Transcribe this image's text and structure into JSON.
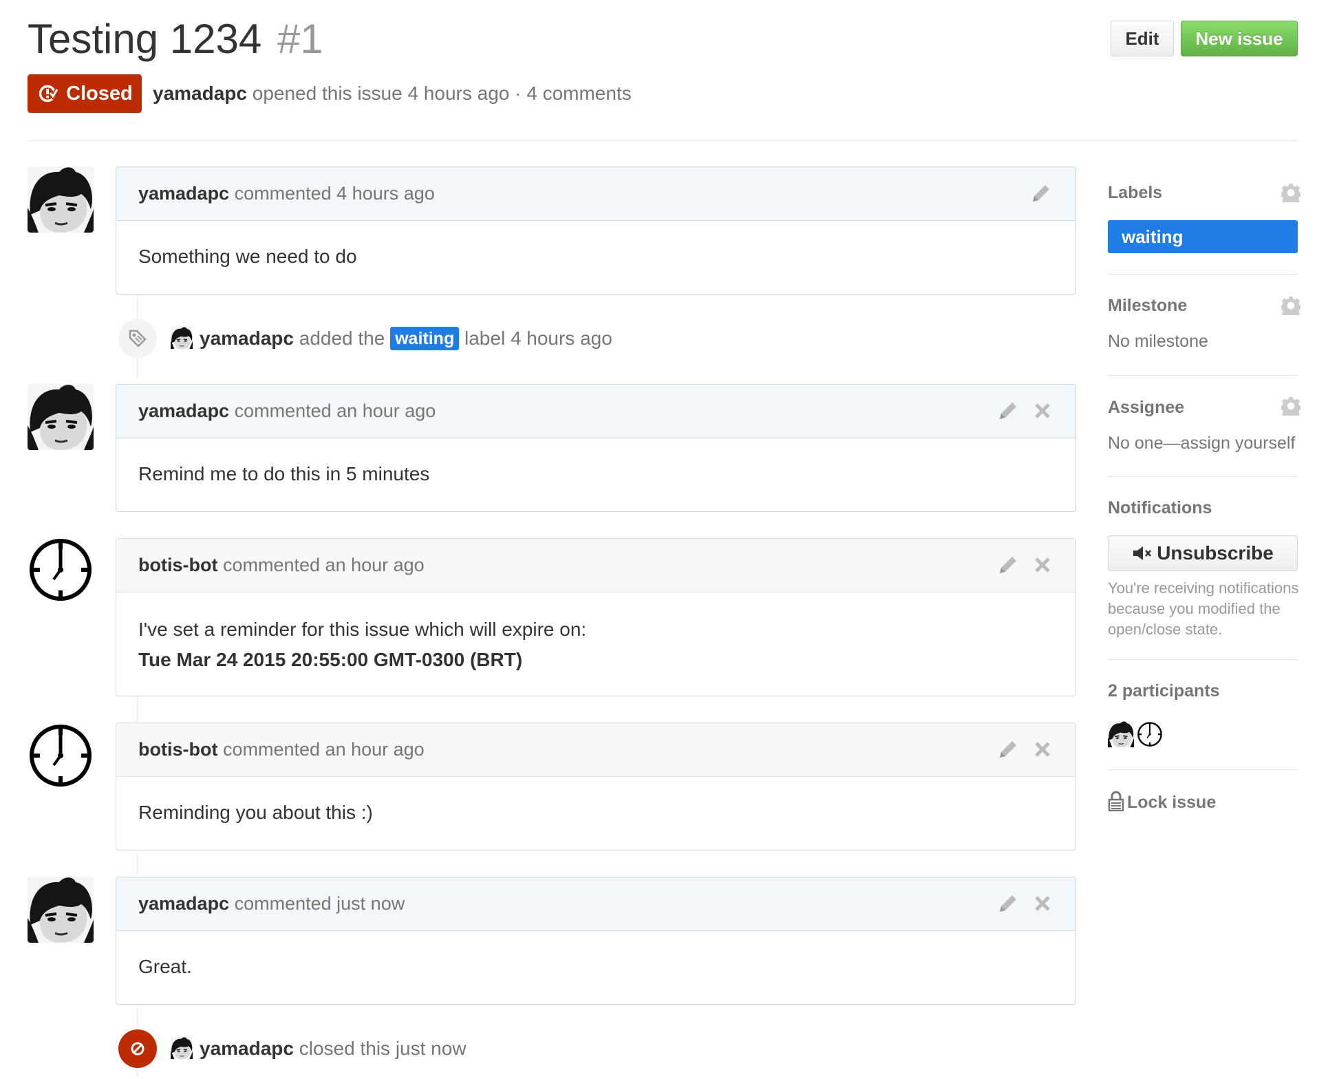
{
  "header": {
    "title": "Testing 1234",
    "number": "#1",
    "edit_label": "Edit",
    "new_issue_label": "New issue",
    "state": "Closed",
    "author": "yamadapc",
    "opened_text": "opened this issue 4 hours ago · 4 comments"
  },
  "timeline": {
    "c1": {
      "author": "yamadapc",
      "meta": "commented 4 hours ago",
      "body": "Something we need to do"
    },
    "ev1": {
      "author": "yamadapc",
      "pre": "added the",
      "label": "waiting",
      "post": "label 4 hours ago"
    },
    "c2": {
      "author": "yamadapc",
      "meta": "commented an hour ago",
      "body": "Remind me to do this in 5 minutes"
    },
    "c3": {
      "author": "botis-bot",
      "meta": "commented an hour ago",
      "body_line1": "I've set a reminder for this issue which will expire on:",
      "body_line2": "Tue Mar 24 2015 20:55:00 GMT-0300 (BRT)"
    },
    "c4": {
      "author": "botis-bot",
      "meta": "commented an hour ago",
      "body": "Reminding you about this :)"
    },
    "c5": {
      "author": "yamadapc",
      "meta": "commented just now",
      "body": "Great."
    },
    "ev2": {
      "author": "yamadapc",
      "text": "closed this just now"
    }
  },
  "sidebar": {
    "labels_heading": "Labels",
    "label_waiting": "waiting",
    "milestone_heading": "Milestone",
    "milestone_value": "No milestone",
    "assignee_heading": "Assignee",
    "assignee_value": "No one—assign yourself",
    "notifications_heading": "Notifications",
    "unsubscribe_label": "Unsubscribe",
    "notification_note": "You're receiving notifications because you modified the open/close state.",
    "participants_heading": "2 participants",
    "lock_label": "Lock issue"
  },
  "colors": {
    "closed": "#bd2c00",
    "label": "#207de5",
    "new_issue": "#60b044"
  }
}
